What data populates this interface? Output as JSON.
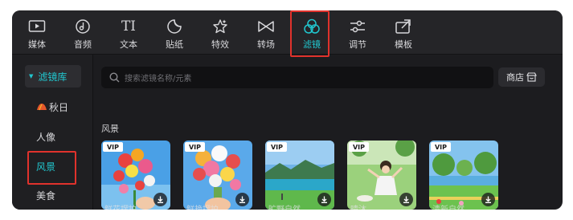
{
  "tabs": [
    {
      "label": "媒体",
      "icon": "media-icon"
    },
    {
      "label": "音频",
      "icon": "audio-icon"
    },
    {
      "label": "文本",
      "icon": "text-icon"
    },
    {
      "label": "贴纸",
      "icon": "sticker-icon"
    },
    {
      "label": "特效",
      "icon": "effects-icon"
    },
    {
      "label": "转场",
      "icon": "transition-icon"
    },
    {
      "label": "滤镜",
      "icon": "filter-icon",
      "active": true
    },
    {
      "label": "调节",
      "icon": "adjust-icon"
    },
    {
      "label": "模板",
      "icon": "template-icon"
    }
  ],
  "tab_text_icon": "TI",
  "sidebar": {
    "library_label": "滤镜库",
    "items": [
      "秋日",
      "人像",
      "风景",
      "美食"
    ]
  },
  "search": {
    "placeholder": "搜索滤镜名称/元素"
  },
  "store_label": "商店",
  "section_title": "风景",
  "badge_label": "VIP",
  "filters": [
    {
      "caption": "鲜花摆拍",
      "vip": true
    },
    {
      "caption": "鲜艳摆拍",
      "vip": true
    },
    {
      "caption": "旷野自然",
      "vip": true
    },
    {
      "caption": "晴沐",
      "vip": true
    },
    {
      "caption": "清新自然",
      "vip": true
    }
  ],
  "colors": {
    "accent": "#21c7cf",
    "highlight_box": "#e0322c",
    "background": "#1c1c1f"
  }
}
